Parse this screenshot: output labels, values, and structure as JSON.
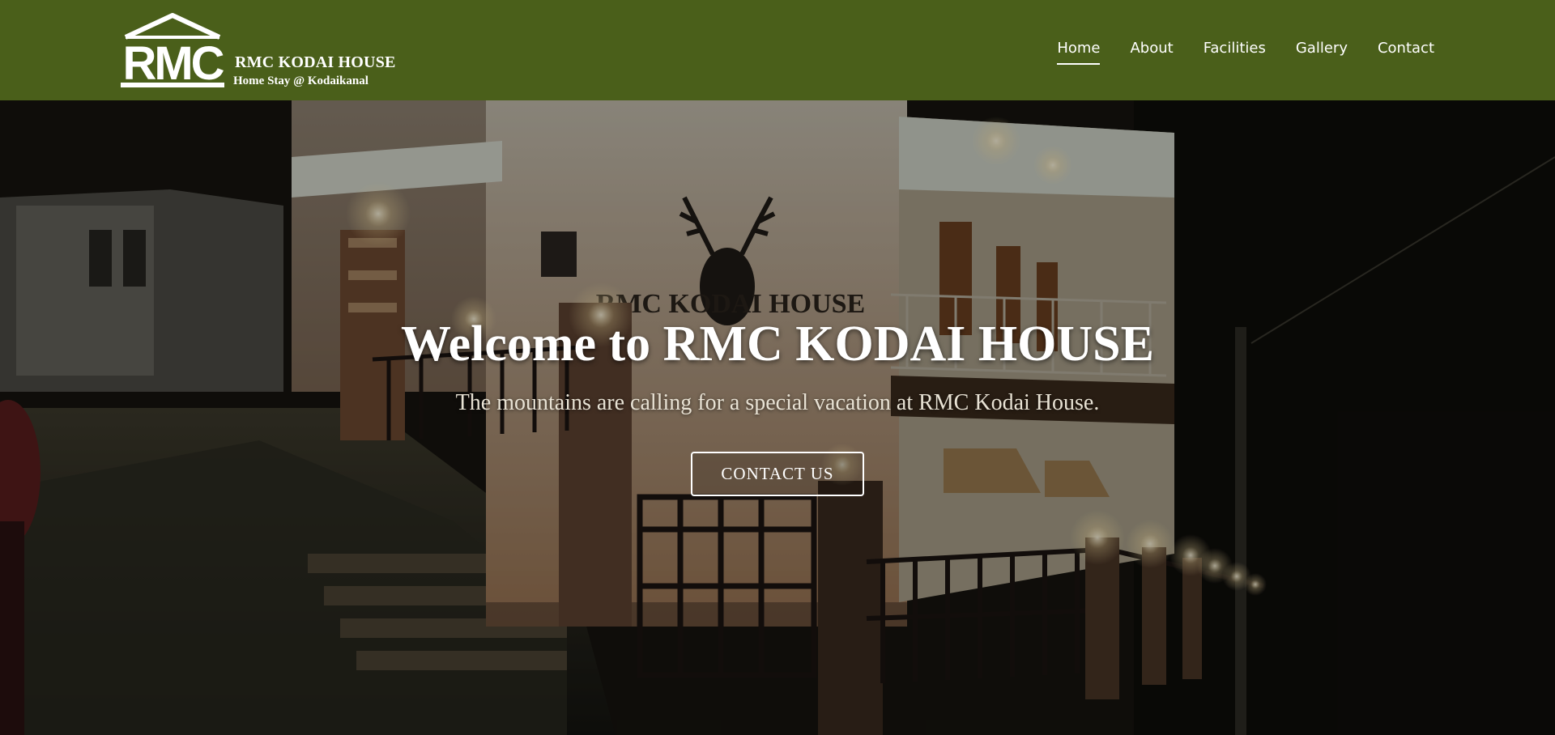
{
  "brand": {
    "logo_letters": "RMC",
    "name": "RMC KODAI HOUSE",
    "tagline": "Home Stay @ Kodaikanal"
  },
  "nav": {
    "items": [
      {
        "label": "Home",
        "active": true
      },
      {
        "label": "About",
        "active": false
      },
      {
        "label": "Facilities",
        "active": false
      },
      {
        "label": "Gallery",
        "active": false
      },
      {
        "label": "Contact",
        "active": false
      }
    ]
  },
  "hero": {
    "title": "Welcome to RMC KODAI HOUSE",
    "subtitle": "The mountains are calling for a special vacation at RMC Kodai House.",
    "button_label": "CONTACT US",
    "wall_sign": "RMC KODAI HOUSE"
  },
  "colors": {
    "header_bg": "#4a5f1a",
    "text": "#ffffff"
  }
}
